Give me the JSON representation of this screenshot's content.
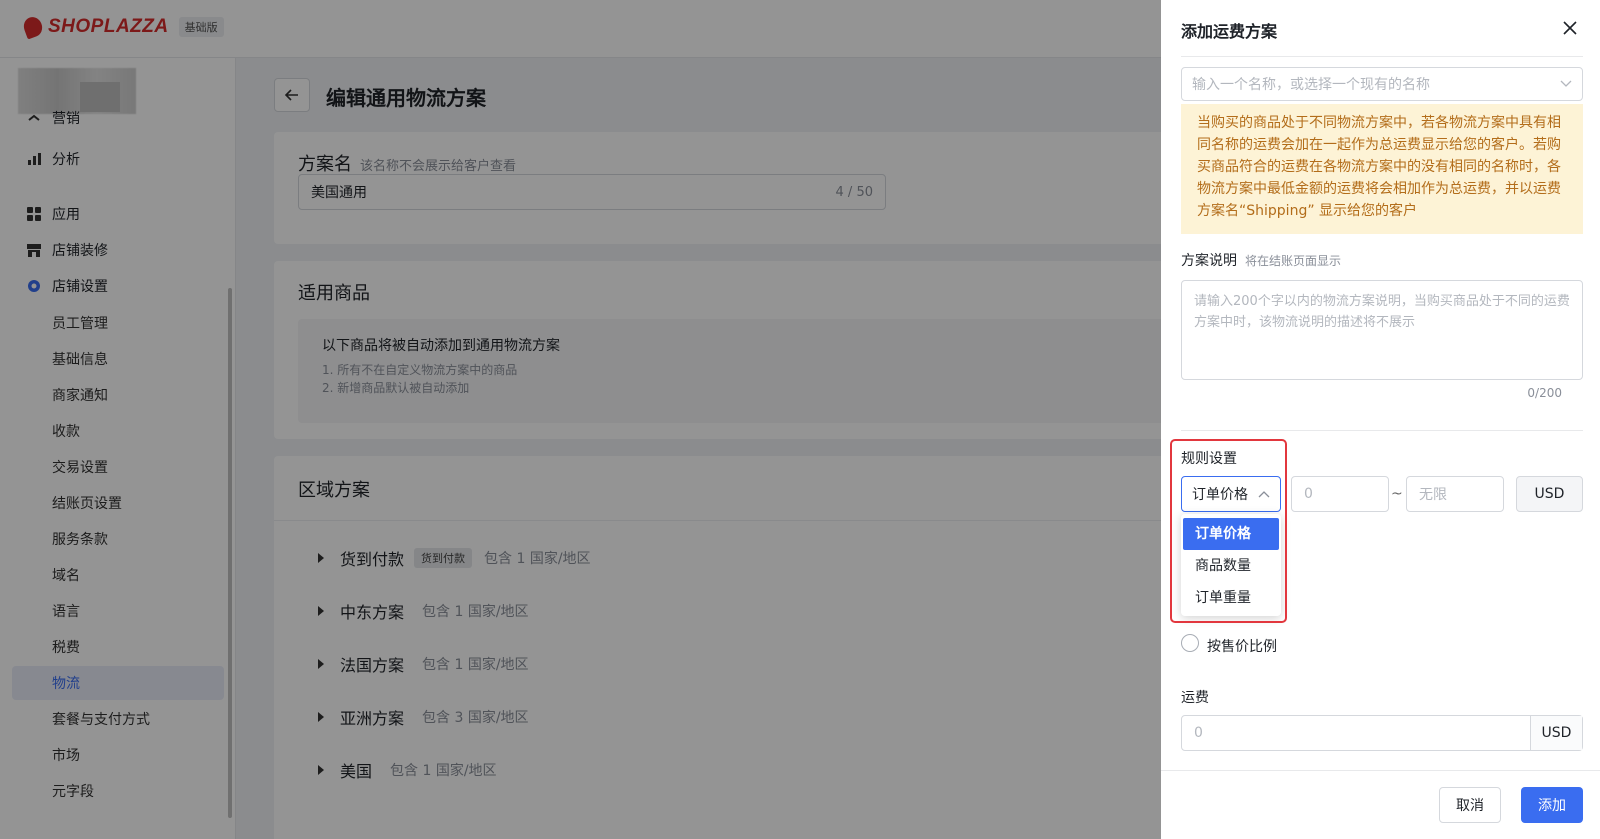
{
  "app": {
    "brand": "SHOPLAZZA",
    "edition": "基础版",
    "colors": {
      "accent": "#3a6df0",
      "brand": "#d62b2b",
      "warning_bg": "#fdf3d6",
      "warning_text": "#b36d1a",
      "highlight": "#e2373e"
    }
  },
  "sidebar": {
    "partial_item": "营销",
    "items": [
      {
        "label": "分析",
        "icon": "bar-chart-icon"
      },
      {
        "label": "应用",
        "icon": "apps-icon"
      },
      {
        "label": "店铺装修",
        "icon": "store-icon"
      },
      {
        "label": "店铺设置",
        "icon": "gear-icon"
      }
    ],
    "sub_items": [
      "员工管理",
      "基础信息",
      "商家通知",
      "收款",
      "交易设置",
      "结账页设置",
      "服务条款",
      "域名",
      "语言",
      "税费",
      "物流",
      "套餐与支付方式",
      "市场",
      "元字段"
    ],
    "active_sub": "物流"
  },
  "main": {
    "page_title": "编辑通用物流方案",
    "plan_name": {
      "label": "方案名",
      "hint": "该名称不会展示给客户查看",
      "value": "美国通用",
      "counter": "4 / 50"
    },
    "products": {
      "title": "适用商品",
      "auto_text": "以下商品将被自动添加到通用物流方案",
      "notes": [
        "1. 所有不在自定义物流方案中的商品",
        "2. 新增商品默认被自动添加"
      ]
    },
    "zones": {
      "title": "区域方案",
      "rows": [
        {
          "name": "货到付款",
          "tag": "货到付款",
          "count": "包含 1 国家/地区"
        },
        {
          "name": "中东方案",
          "tag": "",
          "count": "包含 1 国家/地区"
        },
        {
          "name": "法国方案",
          "tag": "",
          "count": "包含 1 国家/地区"
        },
        {
          "name": "亚洲方案",
          "tag": "",
          "count": "包含 3 国家/地区"
        },
        {
          "name": "美国",
          "tag": "",
          "count": "包含 1 国家/地区"
        }
      ]
    }
  },
  "drawer": {
    "title": "添加运费方案",
    "name_placeholder": "输入一个名称，或选择一个现有的名称",
    "warning": "当购买的商品处于不同物流方案中，若各物流方案中具有相同名称的运费会加在一起作为总运费显示给您的客户。若购买商品符合的运费在各物流方案中的没有相同的名称时，各物流方案中最低金额的运费将会相加作为总运费，并以运费方案名“Shipping” 显示给您的客户",
    "desc_label": "方案说明",
    "desc_hint": "将在结账页面显示",
    "desc_placeholder": "请输入200个字以内的物流方案说明，当购买商品处于不同的运费方案中时，该物流说明的描述将不展示",
    "desc_counter": "0/200",
    "rule_label": "规则设置",
    "rule_selected": "订单价格",
    "rule_options": [
      "订单价格",
      "商品数量",
      "订单重量"
    ],
    "range_min_placeholder": "0",
    "range_sep": "~",
    "range_max_placeholder": "无限",
    "currency": "USD",
    "radio_label": "按售价比例",
    "fee_label": "运费",
    "fee_placeholder": "0",
    "fee_currency": "USD",
    "cancel": "取消",
    "add": "添加"
  }
}
